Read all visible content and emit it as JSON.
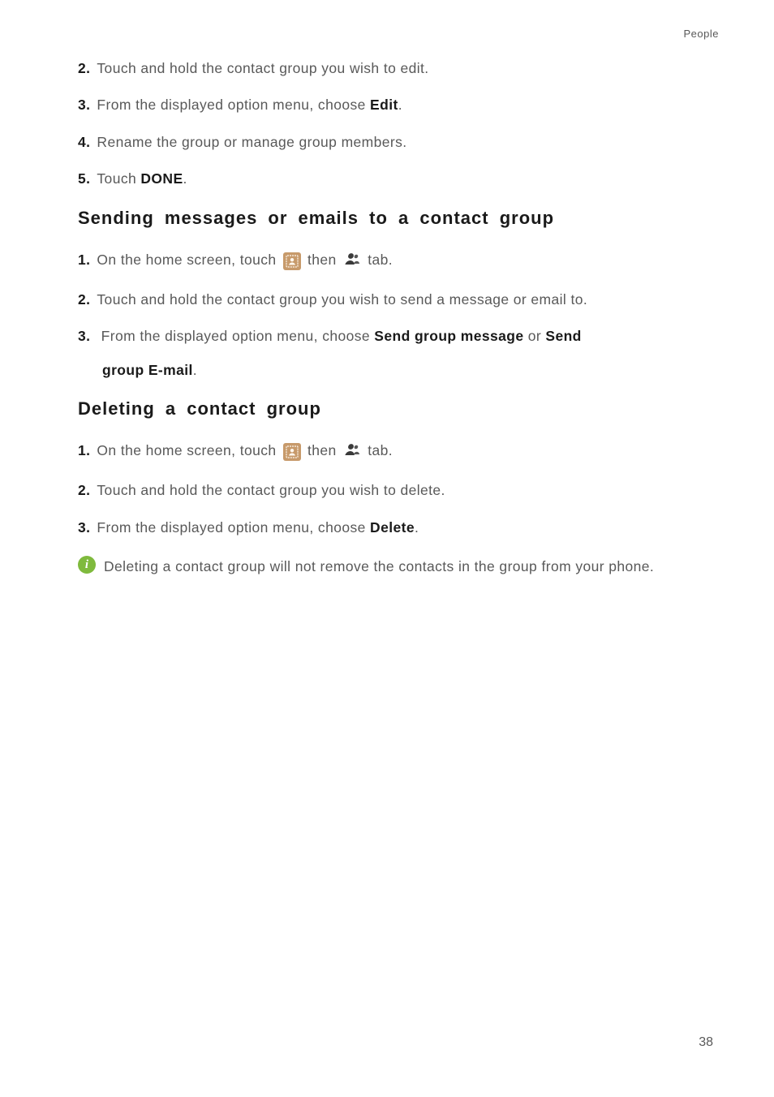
{
  "header": {
    "section_label": "People"
  },
  "section1": {
    "steps": [
      {
        "num": "2.",
        "text": "Touch and hold the contact group you wish to edit."
      },
      {
        "num": "3.",
        "pre": "From the displayed option menu, choose ",
        "bold1": "Edit",
        "post": "."
      },
      {
        "num": "4.",
        "text": "Rename the group or manage group members."
      },
      {
        "num": "5.",
        "pre": "Touch ",
        "bold1": "DONE",
        "post": "."
      }
    ]
  },
  "section2": {
    "heading": "Sending messages or emails to a contact group",
    "steps": [
      {
        "num": "1.",
        "pre": "On the home screen, touch ",
        "mid": " then ",
        "post": " tab."
      },
      {
        "num": "2.",
        "text": "Touch and hold the contact group you wish to send a message or email to."
      },
      {
        "num": "3.",
        "pre": "From the displayed option menu, choose ",
        "bold1": "Send group message",
        "mid": " or ",
        "bold2": "Send",
        "line2_bold": "group E-mail",
        "line2_post": "."
      }
    ]
  },
  "section3": {
    "heading": "Deleting a contact group",
    "steps": [
      {
        "num": "1.",
        "pre": "On the home screen, touch ",
        "mid": " then ",
        "post": " tab."
      },
      {
        "num": "2.",
        "text": "Touch and hold the contact group you wish to delete."
      },
      {
        "num": "3.",
        "pre": "From the displayed option menu, choose ",
        "bold1": "Delete",
        "post": "."
      }
    ],
    "note": "Deleting a contact group will not remove the contacts in the group from your phone."
  },
  "page_number": "38",
  "icons": {
    "contacts_app": "contacts-app-icon",
    "group_tab": "contact-group-icon",
    "info": "info-icon"
  }
}
